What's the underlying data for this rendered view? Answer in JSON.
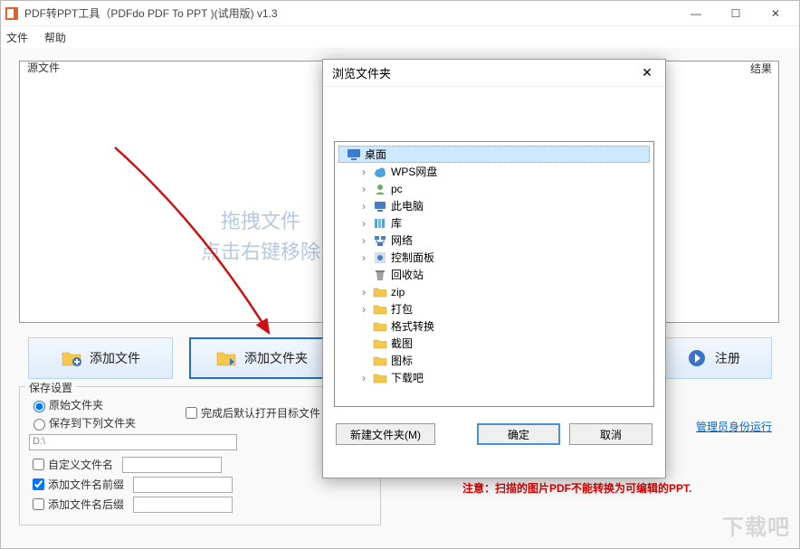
{
  "window": {
    "title": "PDF转PPT工具（PDFdo PDF To PPT )(试用版) v1.3"
  },
  "menu": {
    "file": "文件",
    "help": "帮助"
  },
  "src_label": "源文件",
  "results_label": "结果",
  "watermark_line1": "拖拽文件",
  "watermark_line2": "点击右键移除",
  "buttons": {
    "add_files": "添加文件",
    "add_folder": "添加文件夹",
    "register": "注册"
  },
  "open_target_after": "完成后默认打开目标文件",
  "save": {
    "legend": "保存设置",
    "orig_folder": "原始文件夹",
    "to_folder": "保存到下列文件夹",
    "path": "D:\\",
    "custom_name": "自定义文件名",
    "add_prefix": "添加文件名前缀",
    "add_suffix": "添加文件名后缀"
  },
  "admin_link": "管理员身份运行",
  "warning_text": "注意：扫描的图片PDF不能转换为可编辑的PPT.",
  "dialog": {
    "title": "浏览文件夹",
    "new_folder": "新建文件夹(M)",
    "ok": "确定",
    "cancel": "取消",
    "root": "桌面",
    "items": [
      {
        "label": "WPS网盘",
        "icon": "cloud",
        "expandable": true
      },
      {
        "label": "pc",
        "icon": "user",
        "expandable": true
      },
      {
        "label": "此电脑",
        "icon": "pc",
        "expandable": true
      },
      {
        "label": "库",
        "icon": "lib",
        "expandable": true
      },
      {
        "label": "网络",
        "icon": "net",
        "expandable": true
      },
      {
        "label": "控制面板",
        "icon": "cpl",
        "expandable": true
      },
      {
        "label": "回收站",
        "icon": "bin",
        "expandable": false
      },
      {
        "label": "zip",
        "icon": "folder",
        "expandable": true
      },
      {
        "label": "打包",
        "icon": "folder",
        "expandable": true
      },
      {
        "label": "格式转换",
        "icon": "folder",
        "expandable": false
      },
      {
        "label": "截图",
        "icon": "folder",
        "expandable": false
      },
      {
        "label": "图标",
        "icon": "folder",
        "expandable": false
      },
      {
        "label": "下载吧",
        "icon": "folder",
        "expandable": true
      }
    ]
  },
  "site_watermark": "下载吧"
}
